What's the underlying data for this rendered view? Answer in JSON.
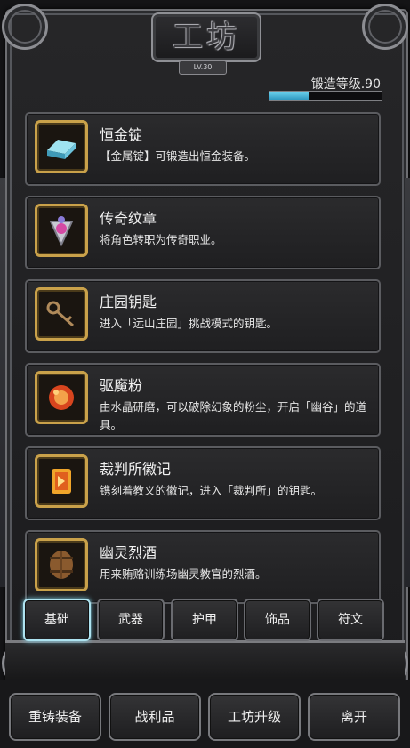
{
  "header": {
    "title": "工坊",
    "level_badge": "LV.30",
    "forge_label": "锻造等级.90",
    "forge_progress": 0.35
  },
  "items": [
    {
      "name": "恒金锭",
      "desc": "【金属锭】可锻造出恒金装备。",
      "icon": "ingot-icon"
    },
    {
      "name": "传奇纹章",
      "desc": "将角色转职为传奇职业。",
      "icon": "emblem-icon"
    },
    {
      "name": "庄园钥匙",
      "desc": "进入「远山庄园」挑战模式的钥匙。",
      "icon": "key-icon"
    },
    {
      "name": "驱魔粉",
      "desc": "由水晶研磨，可以破除幻象的粉尘，开启「幽谷」的道具。",
      "icon": "powder-icon"
    },
    {
      "name": "裁判所徽记",
      "desc": "镌刻着教义的徽记，进入「裁判所」的钥匙。",
      "icon": "insignia-icon"
    },
    {
      "name": "幽灵烈酒",
      "desc": "用来贿赂训练场幽灵教官的烈酒。",
      "icon": "barrel-icon"
    }
  ],
  "tabs": [
    "基础",
    "武器",
    "护甲",
    "饰品",
    "符文"
  ],
  "active_tab": "基础",
  "bottom_buttons": [
    "重铸装备",
    "战利品",
    "工坊升级",
    "离开"
  ],
  "colors": {
    "accent_cyan": "#7fd0e6",
    "icon_frame_gold": "#c9a14a",
    "progress_fill": "#4fb4d8"
  }
}
